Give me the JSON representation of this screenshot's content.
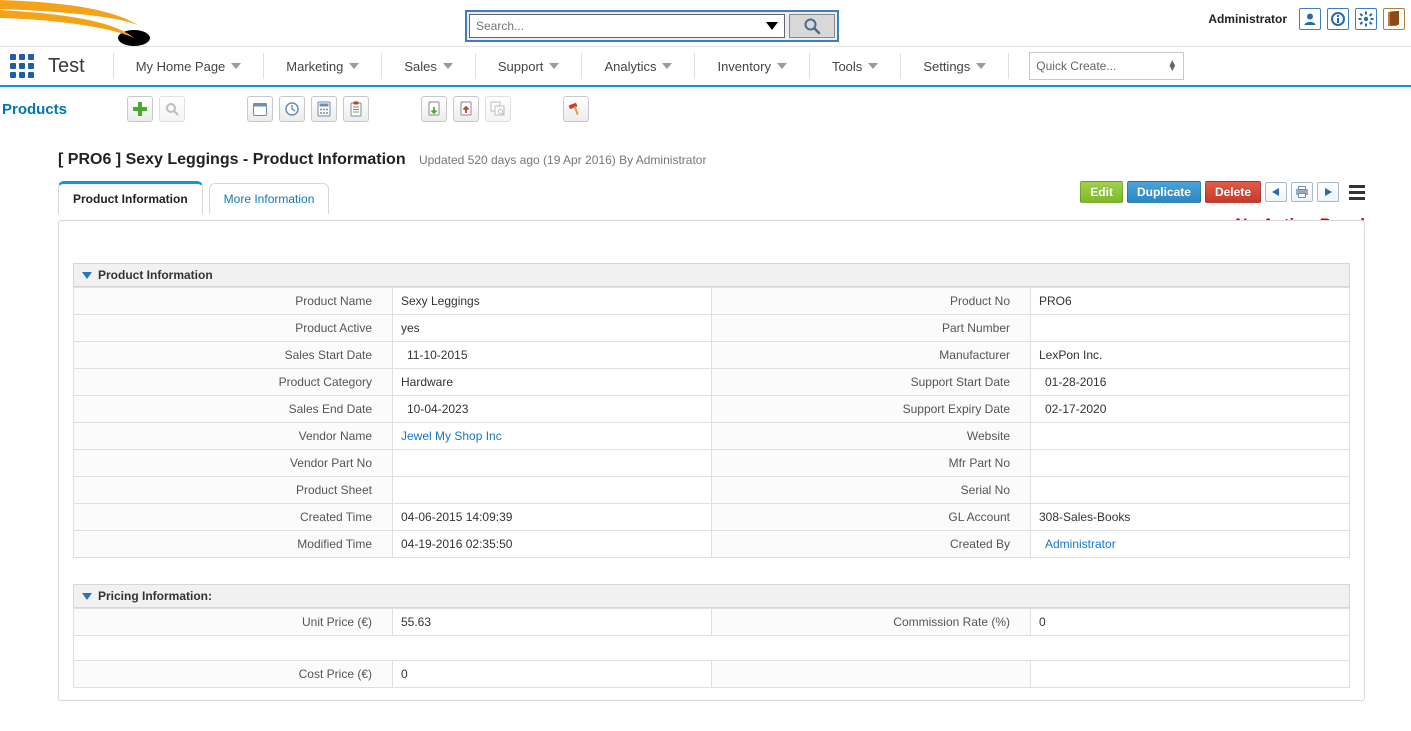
{
  "header": {
    "search_placeholder": "Search...",
    "admin_label": "Administrator"
  },
  "menu": {
    "app_name": "Test",
    "items": [
      "My Home Page",
      "Marketing",
      "Sales",
      "Support",
      "Analytics",
      "Inventory",
      "Tools",
      "Settings"
    ],
    "quick_create": "Quick Create..."
  },
  "toolbar": {
    "section": "Products"
  },
  "record": {
    "title": "[ PRO6 ] Sexy Leggings - Product Information",
    "subtitle": "Updated 520 days ago (19 Apr 2016) By Administrator"
  },
  "tabs": {
    "active": "Product Information",
    "secondary": "More Information"
  },
  "actions": {
    "edit": "Edit",
    "duplicate": "Duplicate",
    "delete": "Delete"
  },
  "annotations": {
    "no_action_panel": "No Action Panel"
  },
  "sections": {
    "product_info": {
      "title": "Product Information",
      "rows": [
        {
          "k1": "Product Name",
          "v1": "Sexy Leggings",
          "k2": "Product No",
          "v2": "PRO6"
        },
        {
          "k1": "Product Active",
          "v1": "yes",
          "k2": "Part Number",
          "v2": ""
        },
        {
          "k1": "Sales Start Date",
          "v1": "11-10-2015",
          "v1pad": true,
          "k2": "Manufacturer",
          "v2": "LexPon Inc."
        },
        {
          "k1": "Product Category",
          "v1": "Hardware",
          "k2": "Support Start Date",
          "v2": "01-28-2016",
          "v2pad": true
        },
        {
          "k1": "Sales End Date",
          "v1": "10-04-2023",
          "v1pad": true,
          "k2": "Support Expiry Date",
          "v2": "02-17-2020",
          "v2pad": true
        },
        {
          "k1": "Vendor Name",
          "v1": "Jewel My Shop Inc",
          "v1link": true,
          "k2": "Website",
          "v2": ""
        },
        {
          "k1": "Vendor Part No",
          "v1": "",
          "k2": "Mfr Part No",
          "v2": ""
        },
        {
          "k1": "Product Sheet",
          "v1": "",
          "k2": "Serial No",
          "v2": ""
        },
        {
          "k1": "Created Time",
          "v1": "04-06-2015 14:09:39",
          "k2": "GL Account",
          "v2": "308-Sales-Books"
        },
        {
          "k1": "Modified Time",
          "v1": "04-19-2016 02:35:50",
          "k2": "Created By",
          "v2": "Administrator",
          "v2link": true,
          "v2pad": true
        }
      ]
    },
    "pricing_info": {
      "title": "Pricing Information:",
      "rows": [
        {
          "k1": "Unit Price (€)",
          "v1": "55.63",
          "k2": "Commission Rate (%)",
          "v2": "0"
        },
        {
          "spacer": true
        },
        {
          "k1": "Cost Price (€)",
          "v1": "0",
          "k2": "",
          "v2": ""
        }
      ]
    }
  }
}
